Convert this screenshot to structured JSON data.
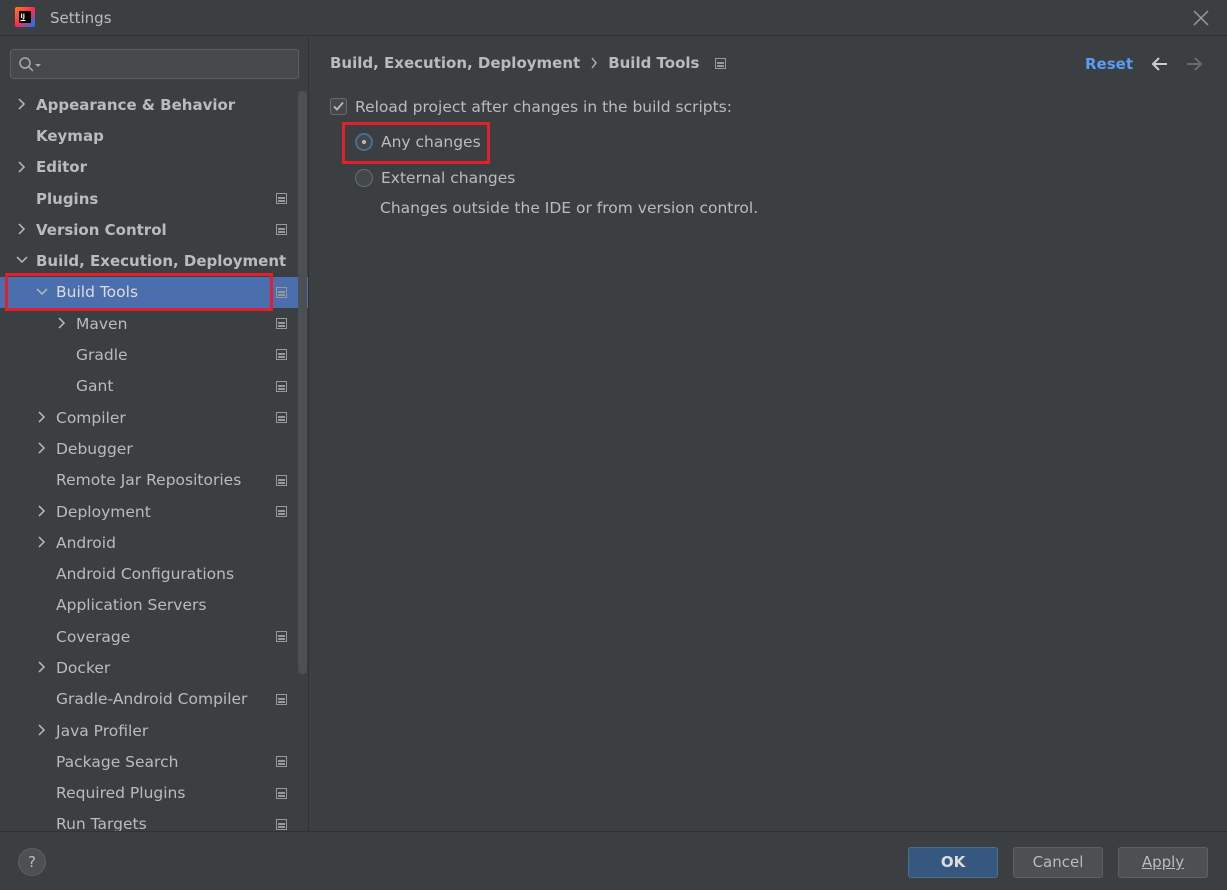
{
  "window": {
    "title": "Settings"
  },
  "search": {
    "placeholder": "",
    "value": ""
  },
  "sidebar": {
    "items": [
      {
        "label": "Appearance & Behavior",
        "level": 0,
        "bold": true,
        "expandable": true,
        "expanded": false,
        "project_icon": false
      },
      {
        "label": "Keymap",
        "level": 0,
        "bold": true,
        "expandable": false,
        "project_icon": false
      },
      {
        "label": "Editor",
        "level": 0,
        "bold": true,
        "expandable": true,
        "expanded": false,
        "project_icon": false
      },
      {
        "label": "Plugins",
        "level": 0,
        "bold": true,
        "expandable": false,
        "project_icon": true
      },
      {
        "label": "Version Control",
        "level": 0,
        "bold": true,
        "expandable": true,
        "expanded": false,
        "project_icon": true
      },
      {
        "label": "Build, Execution, Deployment",
        "level": 0,
        "bold": true,
        "expandable": true,
        "expanded": true,
        "project_icon": false
      },
      {
        "label": "Build Tools",
        "level": 1,
        "bold": false,
        "expandable": true,
        "expanded": true,
        "project_icon": true,
        "selected": true
      },
      {
        "label": "Maven",
        "level": 2,
        "bold": false,
        "expandable": true,
        "expanded": false,
        "project_icon": true
      },
      {
        "label": "Gradle",
        "level": 2,
        "bold": false,
        "expandable": false,
        "project_icon": true
      },
      {
        "label": "Gant",
        "level": 2,
        "bold": false,
        "expandable": false,
        "project_icon": true
      },
      {
        "label": "Compiler",
        "level": 1,
        "bold": false,
        "expandable": true,
        "expanded": false,
        "project_icon": true
      },
      {
        "label": "Debugger",
        "level": 1,
        "bold": false,
        "expandable": true,
        "expanded": false,
        "project_icon": false
      },
      {
        "label": "Remote Jar Repositories",
        "level": 1,
        "bold": false,
        "expandable": false,
        "project_icon": true
      },
      {
        "label": "Deployment",
        "level": 1,
        "bold": false,
        "expandable": true,
        "expanded": false,
        "project_icon": true
      },
      {
        "label": "Android",
        "level": 1,
        "bold": false,
        "expandable": true,
        "expanded": false,
        "project_icon": false
      },
      {
        "label": "Android Configurations",
        "level": 1,
        "bold": false,
        "expandable": false,
        "project_icon": false
      },
      {
        "label": "Application Servers",
        "level": 1,
        "bold": false,
        "expandable": false,
        "project_icon": false
      },
      {
        "label": "Coverage",
        "level": 1,
        "bold": false,
        "expandable": false,
        "project_icon": true
      },
      {
        "label": "Docker",
        "level": 1,
        "bold": false,
        "expandable": true,
        "expanded": false,
        "project_icon": false
      },
      {
        "label": "Gradle-Android Compiler",
        "level": 1,
        "bold": false,
        "expandable": false,
        "project_icon": true
      },
      {
        "label": "Java Profiler",
        "level": 1,
        "bold": false,
        "expandable": true,
        "expanded": false,
        "project_icon": false
      },
      {
        "label": "Package Search",
        "level": 1,
        "bold": false,
        "expandable": false,
        "project_icon": true
      },
      {
        "label": "Required Plugins",
        "level": 1,
        "bold": false,
        "expandable": false,
        "project_icon": true
      },
      {
        "label": "Run Targets",
        "level": 1,
        "bold": false,
        "expandable": false,
        "project_icon": true
      }
    ]
  },
  "main": {
    "breadcrumb": {
      "parent": "Build, Execution, Deployment",
      "current": "Build Tools"
    },
    "reset_label": "Reset",
    "reload_checkbox": {
      "label": "Reload project after changes in the build scripts:",
      "checked": true
    },
    "radio_any": {
      "label": "Any changes",
      "checked": true
    },
    "radio_external": {
      "label": "External changes",
      "checked": false
    },
    "hint": "Changes outside the IDE or from version control."
  },
  "footer": {
    "help_label": "?",
    "ok_label": "OK",
    "cancel_label": "Cancel",
    "apply_label": "Apply"
  },
  "colors": {
    "background": "#3c3f41",
    "selection": "#4b6eaf",
    "accent_link": "#589df6",
    "highlight_box": "#e0202a",
    "primary_button": "#365880"
  }
}
